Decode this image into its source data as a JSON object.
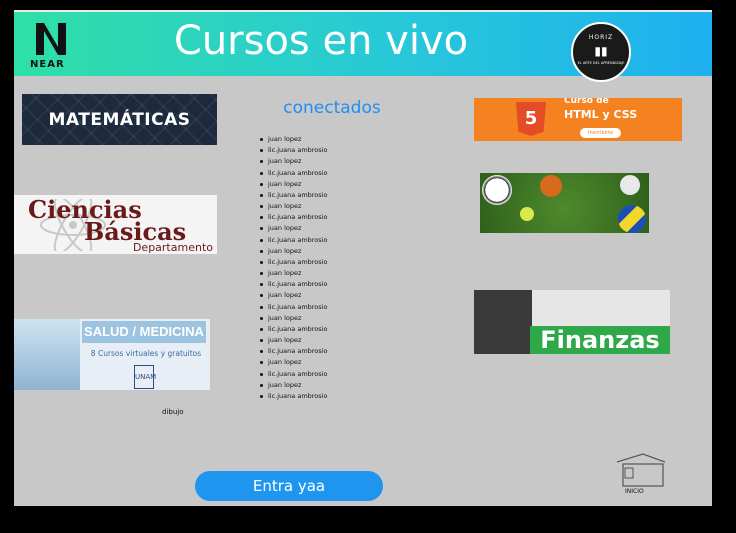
{
  "header": {
    "logo_text": "NEAR",
    "title": "Cursos en vivo",
    "badge": {
      "top": "HORIZ",
      "bottom": "EL ARTE DEL APRENDIZAJE"
    }
  },
  "courses_left": {
    "matematicas": "MATEMÁTICAS",
    "ciencias_line1": "Ciencias",
    "ciencias_line2": "Básicas",
    "ciencias_line3": "Departamento",
    "salud_header": "SALUD / MEDICINA",
    "salud_sub": "8 Cursos virtuales y gratuitos",
    "salud_seal": "UNAM",
    "dibujo_label": "dibujo"
  },
  "connected": {
    "title": "conectados",
    "users": [
      "juan lopez",
      "lic.juana ambrosio",
      "juan lopez",
      "lic.juana ambrosio",
      "juan lopez",
      "lic.juana ambrosio",
      "juan lopez",
      "lic.juana ambrosio",
      "juan lopez",
      "lic.juana ambrosio",
      "juan lopez",
      "lic.juana ambrosio",
      "juan lopez",
      "lic.juana ambrosio",
      "juan lopez",
      "lic.juana ambrosio",
      "juan lopez",
      "lic.juana ambrosio",
      "juan lopez",
      "lic.juana ambrosio",
      "juan lopez",
      "lic.juana ambrosio",
      "juan lopez",
      "lic.juana ambrosio"
    ]
  },
  "courses_right": {
    "html_badge": "5",
    "html_course": "Curso de",
    "html_title": "HTML  y  CSS",
    "html_btn": "Inscribirte",
    "finanzas": "Finanzas"
  },
  "actions": {
    "enter_button": "Entra yaa",
    "home_label": "INICIO"
  },
  "colors": {
    "accent": "#1e96f0",
    "header_start": "#2fe0a6",
    "header_end": "#1fb0f0"
  }
}
